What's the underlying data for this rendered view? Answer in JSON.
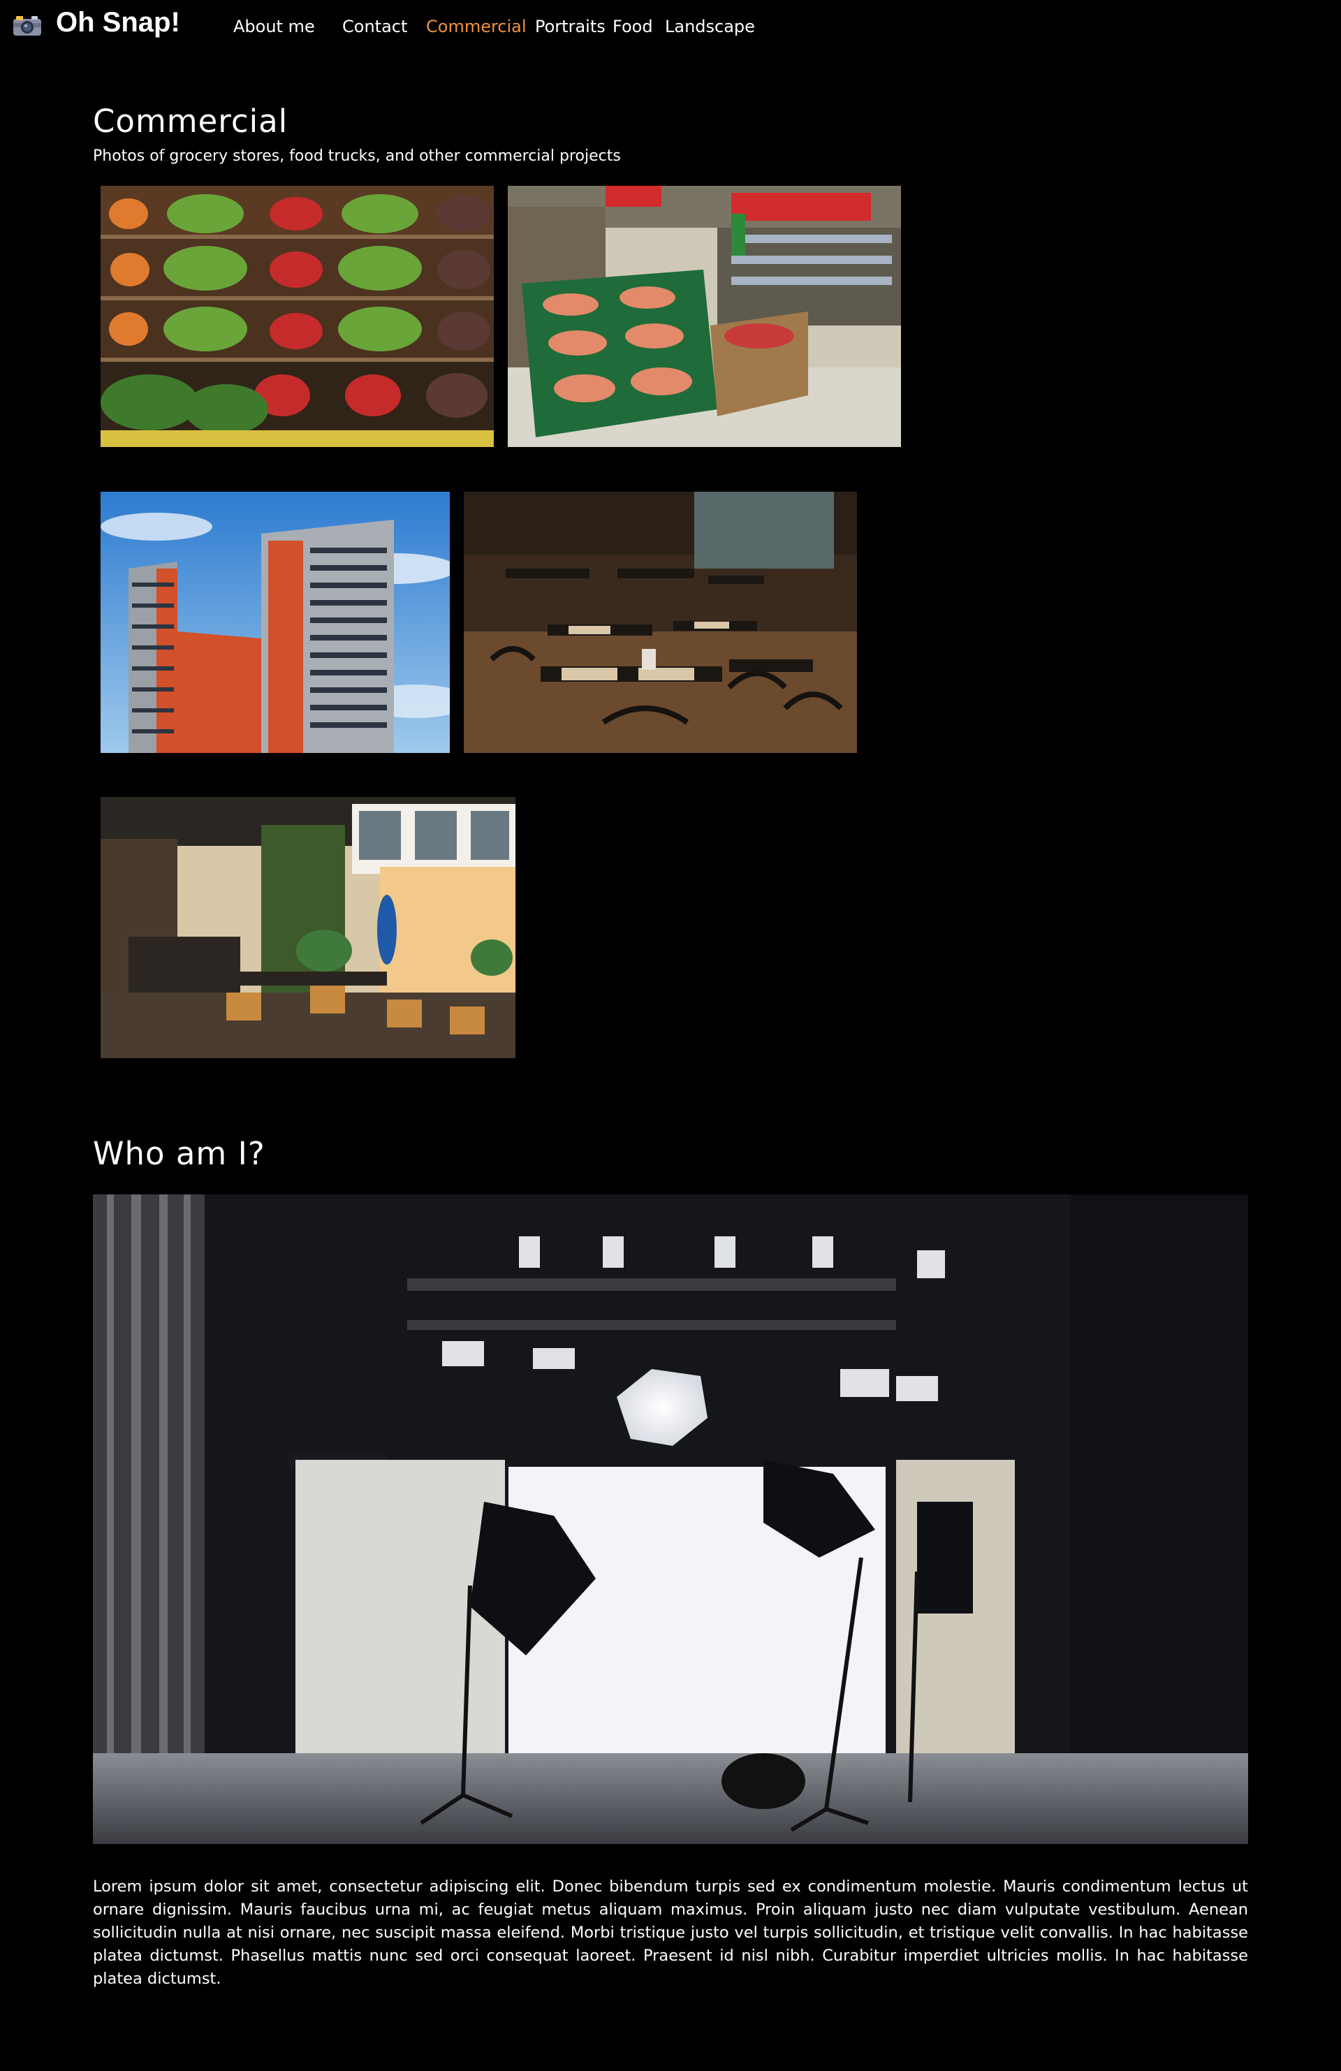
{
  "brand": {
    "title": "Oh Snap!",
    "icon": "camera-icon"
  },
  "nav": {
    "items": [
      {
        "label": "About me",
        "active": false
      },
      {
        "label": "Contact",
        "active": false
      },
      {
        "label": "Commercial",
        "active": true
      },
      {
        "label": "Portraits",
        "active": false
      },
      {
        "label": "Food",
        "active": false
      },
      {
        "label": "Landscape",
        "active": false
      }
    ],
    "active_color": "#f0923a"
  },
  "commercial": {
    "title": "Commercial",
    "subtitle": "Photos of grocery stores, food trucks, and other commercial projects",
    "photos": [
      {
        "subject": "produce shelves"
      },
      {
        "subject": "supermarket aisle"
      },
      {
        "subject": "apartment tower"
      },
      {
        "subject": "restaurant tables"
      },
      {
        "subject": "cafe interior"
      }
    ]
  },
  "about": {
    "title": "Who am I?",
    "photo_subject": "photo studio",
    "paragraph": "Lorem ipsum dolor sit amet, consectetur adipiscing elit. Donec bibendum turpis sed ex condimentum molestie. Mauris condimentum lectus ut ornare dignissim. Mauris faucibus urna mi, ac feugiat metus aliquam maximus. Proin aliquam justo nec diam vulputate vestibulum. Aenean sollicitudin nulla at nisi ornare, nec suscipit massa eleifend. Morbi tristique justo vel turpis sollicitudin, et tristique velit convallis. In hac habitasse platea dictumst. Phasellus mattis nunc sed orci consequat laoreet. Praesent id nisl nibh. Curabitur imperdiet ultricies mollis. In hac habitasse platea dictumst."
  },
  "colors": {
    "background": "#000000",
    "text": "#ffffff",
    "accent": "#f0923a"
  }
}
